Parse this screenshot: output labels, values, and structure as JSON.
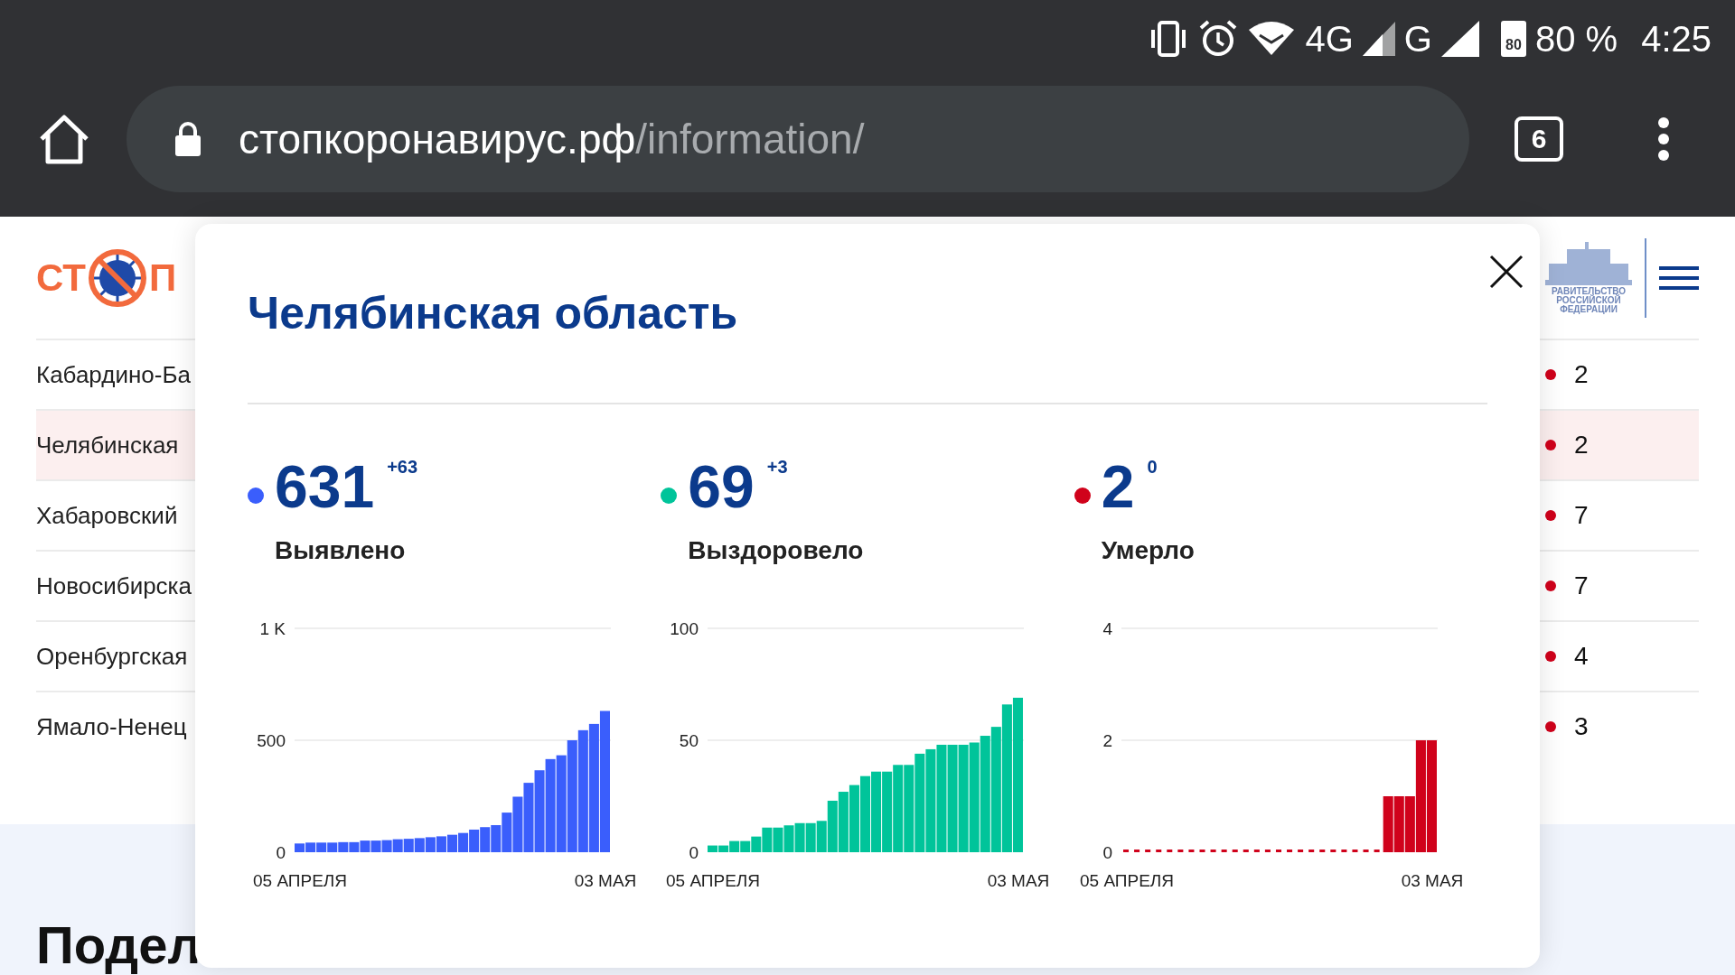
{
  "status_bar": {
    "network": "4G",
    "network_2": "G",
    "battery_icon_text": "80",
    "battery": "80 %",
    "time": "4:25"
  },
  "address_bar": {
    "domain": "стопкоронавирус.рф",
    "path": "/information/",
    "tab_count": "6"
  },
  "site_header": {
    "logo_left": "СТ",
    "logo_right": "П",
    "gov_logo": [
      "РАВИТЕЛЬСТВО",
      "РОССИЙСКОЙ",
      "ФЕДЕРАЦИИ"
    ]
  },
  "regions": [
    {
      "name": "Кабардино-Ба",
      "value": "2",
      "selected": false
    },
    {
      "name": "Челябинская",
      "value": "2",
      "selected": true
    },
    {
      "name": "Хабаровский",
      "value": "7",
      "selected": false
    },
    {
      "name": "Новосибирска",
      "value": "7",
      "selected": false
    },
    {
      "name": "Оренбургская",
      "value": "4",
      "selected": false
    },
    {
      "name": "Ямало-Ненец",
      "value": "3",
      "selected": false
    }
  ],
  "section_heading": "Подел",
  "modal": {
    "title": "Челябинская область",
    "stats": [
      {
        "value": "631",
        "delta": "+63",
        "label": "Выявлено",
        "color": "#3a5efc",
        "chart_data": {
          "type": "bar",
          "categories": [
            "05 АПРЕЛЯ",
            null,
            null,
            null,
            null,
            null,
            null,
            null,
            null,
            null,
            null,
            null,
            null,
            null,
            null,
            null,
            null,
            null,
            null,
            null,
            null,
            null,
            null,
            null,
            null,
            null,
            null,
            null,
            "03 МАЯ"
          ],
          "ylim": [
            0,
            1000
          ],
          "yticks": [
            0,
            500,
            {
              "value": 1000,
              "label": "1 K"
            }
          ],
          "series": [
            {
              "color": "#3a5efc",
              "values": [
                39,
                43,
                43,
                43,
                45,
                45,
                52,
                52,
                54,
                58,
                60,
                63,
                67,
                71,
                78,
                86,
                101,
                112,
                121,
                177,
                248,
                310,
                366,
                416,
                433,
                500,
                545,
                573,
                631
              ]
            }
          ]
        }
      },
      {
        "value": "69",
        "delta": "+3",
        "label": "Выздоровело",
        "color": "#00c49a",
        "chart_data": {
          "type": "bar",
          "categories": [
            "05 АПРЕЛЯ",
            null,
            null,
            null,
            null,
            null,
            null,
            null,
            null,
            null,
            null,
            null,
            null,
            null,
            null,
            null,
            null,
            null,
            null,
            null,
            null,
            null,
            null,
            null,
            null,
            null,
            null,
            null,
            "03 МАЯ"
          ],
          "ylim": [
            0,
            100
          ],
          "yticks": [
            0,
            50,
            100
          ],
          "series": [
            {
              "color": "#00c49a",
              "values": [
                3,
                3,
                5,
                5,
                7,
                11,
                11,
                12,
                13,
                13,
                14,
                23,
                27,
                30,
                34,
                36,
                36,
                39,
                39,
                44,
                46,
                48,
                48,
                48,
                49,
                52,
                56,
                66,
                69
              ]
            }
          ]
        }
      },
      {
        "value": "2",
        "delta": "0",
        "label": "Умерло",
        "color": "#d0021b",
        "chart_data": {
          "type": "bar",
          "categories": [
            "05 АПРЕЛЯ",
            null,
            null,
            null,
            null,
            null,
            null,
            null,
            null,
            null,
            null,
            null,
            null,
            null,
            null,
            null,
            null,
            null,
            null,
            null,
            null,
            null,
            null,
            null,
            null,
            null,
            null,
            null,
            "03 МАЯ"
          ],
          "ylim": [
            0,
            4
          ],
          "yticks": [
            0,
            2,
            4
          ],
          "series": [
            {
              "color": "#d0021b",
              "values": [
                0,
                0,
                0,
                0,
                0,
                0,
                0,
                0,
                0,
                0,
                0,
                0,
                0,
                0,
                0,
                0,
                0,
                0,
                0,
                0,
                0,
                0,
                0,
                0,
                1,
                1,
                1,
                2,
                2
              ]
            }
          ]
        }
      }
    ]
  }
}
